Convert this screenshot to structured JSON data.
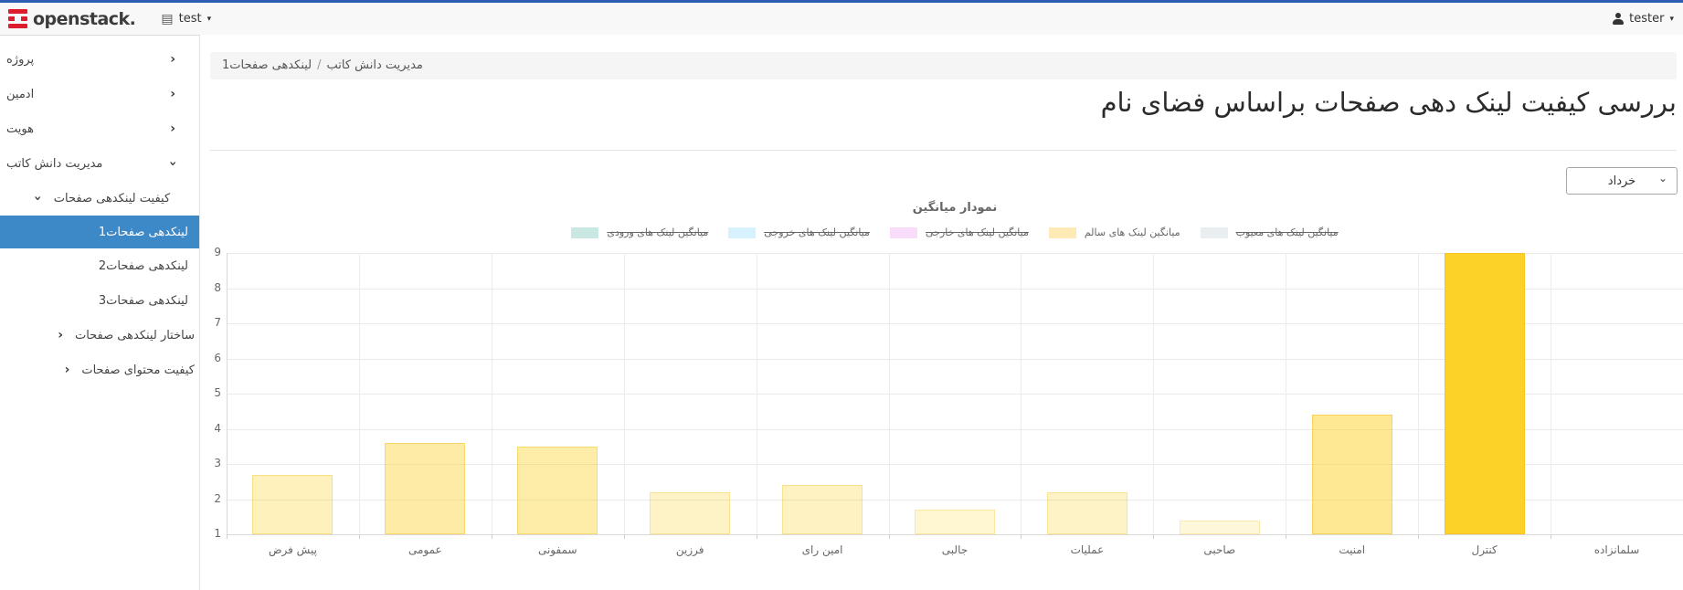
{
  "navbar": {
    "brand": "openstack.",
    "project": "test",
    "user": "tester"
  },
  "sidebar": {
    "items": [
      {
        "label": "پروژه",
        "level": 1,
        "chevron": "right",
        "selected": false
      },
      {
        "label": "ادمین",
        "level": 1,
        "chevron": "right",
        "selected": false
      },
      {
        "label": "هویت",
        "level": 1,
        "chevron": "right",
        "selected": false
      },
      {
        "label": "مدیریت دانش کاتب",
        "level": 1,
        "chevron": "down",
        "selected": false
      },
      {
        "label": "کیفیت لینکدهی صفحات",
        "level": 2,
        "chevron": "down",
        "align": "left",
        "selected": false
      },
      {
        "label": "لینکدهی صفحات1",
        "level": 3,
        "selected": true
      },
      {
        "label": "لینکدهی صفحات2",
        "level": 3,
        "selected": false
      },
      {
        "label": "لینکدهی صفحات3",
        "level": 3,
        "selected": false
      },
      {
        "label": "ساختار لینکدهی صفحات",
        "level": 2,
        "chevron": "right",
        "align": "right",
        "selected": false
      },
      {
        "label": "کیفیت محتوای صفحات",
        "level": 2,
        "chevron": "right",
        "align": "right",
        "selected": false
      }
    ]
  },
  "breadcrumb": {
    "parent": "مدیریت دانش کاتب",
    "separator": "/",
    "current": "لینکدهی صفحات1"
  },
  "page_title": "بررسی کیفیت لینک دهی صفحات براساس فضای نام",
  "month_select": {
    "value": "خرداد"
  },
  "chart_data": {
    "type": "bar",
    "title": "نمودار میانگین",
    "categories": [
      "پیش فرض",
      "عمومی",
      "سمفونی",
      "فرزین",
      "امین رای",
      "جالبی",
      "عملیات",
      "صاحبی",
      "امنیت",
      "کنترل",
      "سلمانزاده"
    ],
    "series": [
      {
        "name": "میانگین لینک های ورودی",
        "swatch": "#c9e8e4",
        "hidden": true
      },
      {
        "name": "میانگین لینک های خروجی",
        "swatch": "#d7f2fc",
        "hidden": true
      },
      {
        "name": "میانگین لینک های خارجی",
        "swatch": "#f9dcfa",
        "hidden": true
      },
      {
        "name": "میانگین لینک های سالم",
        "swatch": "#fdeab4",
        "hidden": false,
        "bar_rgb": [
          253,
          210,
          40
        ],
        "values": [
          2.7,
          3.6,
          3.5,
          2.2,
          2.4,
          1.7,
          2.2,
          1.4,
          4.4,
          9,
          0
        ]
      },
      {
        "name": "میانگین لینک های معیوب",
        "swatch": "#e9eef0",
        "hidden": true
      }
    ],
    "ylim": [
      1,
      9
    ],
    "yticks": [
      1,
      2,
      3,
      4,
      5,
      6,
      7,
      8,
      9
    ],
    "grid": true,
    "legend_position": "top"
  }
}
